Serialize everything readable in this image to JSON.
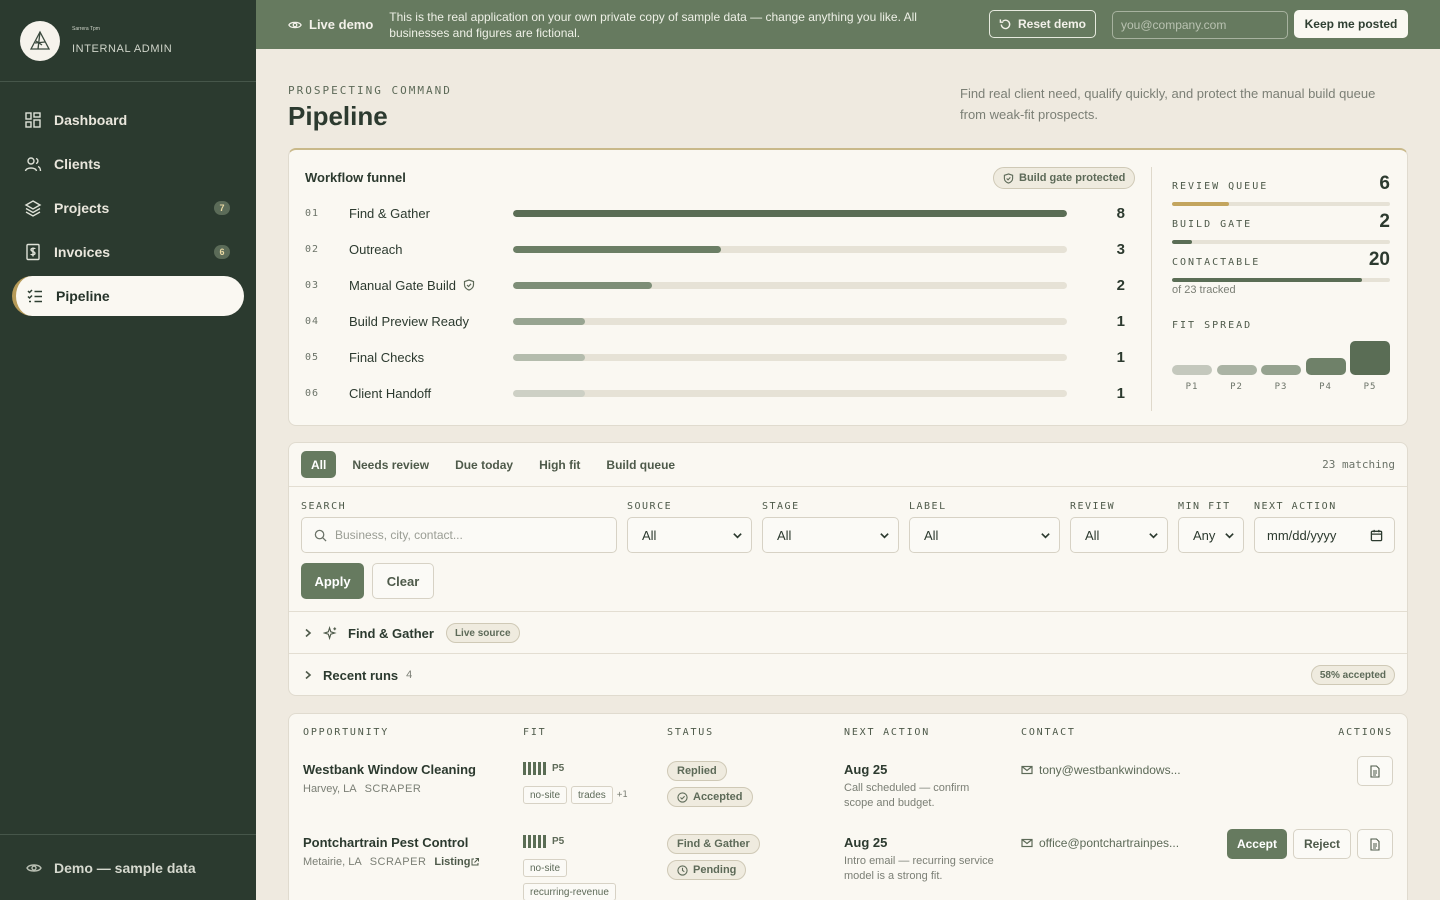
{
  "sidebar": {
    "brand_tiny": "Sarrera Tpm",
    "brand_sub": "INTERNAL ADMIN",
    "items": [
      {
        "label": "Dashboard",
        "icon": "dashboard-icon"
      },
      {
        "label": "Clients",
        "icon": "users-icon"
      },
      {
        "label": "Projects",
        "icon": "layers-icon",
        "count": "7"
      },
      {
        "label": "Invoices",
        "icon": "invoice-icon",
        "count": "6"
      },
      {
        "label": "Pipeline",
        "icon": "checklist-icon",
        "active": true
      }
    ],
    "footer": "Demo — sample data"
  },
  "banner": {
    "live_label": "Live demo",
    "message": "This is the real application on your own private copy of sample data — change anything you like. All businesses and figures are fictional.",
    "reset_label": "Reset demo",
    "email_placeholder": "you@company.com",
    "keep_label": "Keep me posted"
  },
  "header": {
    "eyebrow": "PROSPECTING COMMAND",
    "title": "Pipeline",
    "description": "Find real client need, qualify quickly, and protect the manual build queue from weak-fit prospects."
  },
  "funnel": {
    "title": "Workflow funnel",
    "badge": "Build gate protected",
    "max": 8,
    "stages": [
      {
        "num": "01",
        "label": "Find & Gather",
        "value": 8,
        "color": "#5a6d55"
      },
      {
        "num": "02",
        "label": "Outreach",
        "value": 3,
        "color": "#6b7e65"
      },
      {
        "num": "03",
        "label": "Manual Gate Build",
        "value": 2,
        "color": "#7d8e77",
        "shield": true
      },
      {
        "num": "04",
        "label": "Build Preview Ready",
        "value": 1,
        "color": "#97a491"
      },
      {
        "num": "05",
        "label": "Final Checks",
        "value": 1,
        "color": "#b4bcad"
      },
      {
        "num": "06",
        "label": "Client Handoff",
        "value": 1,
        "color": "#cdd0c5"
      }
    ],
    "metrics": [
      {
        "label": "REVIEW QUEUE",
        "value": "6",
        "fraction": 0.26,
        "color": "#c3a55e"
      },
      {
        "label": "BUILD GATE",
        "value": "2",
        "fraction": 0.09,
        "color": "#5a6d55"
      },
      {
        "label": "CONTACTABLE",
        "value": "20",
        "fraction": 0.87,
        "color": "#5a6d55"
      }
    ],
    "tracked": "of 23 tracked",
    "spread_label": "FIT SPREAD",
    "spread": [
      {
        "label": "P1",
        "value": 1,
        "color": "#c4c8bd"
      },
      {
        "label": "P2",
        "value": 1,
        "color": "#aab3a4"
      },
      {
        "label": "P3",
        "value": 1,
        "color": "#95a28f"
      },
      {
        "label": "P4",
        "value": 2,
        "color": "#6f8169"
      },
      {
        "label": "P5",
        "value": 4,
        "color": "#5a6d55"
      }
    ]
  },
  "filters": {
    "tabs": [
      "All",
      "Needs review",
      "Due today",
      "High fit",
      "Build queue"
    ],
    "active_tab": 0,
    "matching": "23 matching",
    "search_label": "SEARCH",
    "search_placeholder": "Business, city, contact...",
    "fields": [
      {
        "label": "SOURCE",
        "value": "All"
      },
      {
        "label": "STAGE",
        "value": "All"
      },
      {
        "label": "LABEL",
        "value": "All"
      },
      {
        "label": "REVIEW",
        "value": "All"
      },
      {
        "label": "MIN FIT",
        "value": "Any"
      },
      {
        "label": "NEXT ACTION",
        "value": "mm/dd/yyyy"
      }
    ],
    "apply_label": "Apply",
    "clear_label": "Clear",
    "find_gather": {
      "label": "Find & Gather",
      "badge": "Live source"
    },
    "recent_runs": {
      "label": "Recent runs",
      "count": "4",
      "badge": "58% accepted"
    }
  },
  "table": {
    "headers": [
      "OPPORTUNITY",
      "FIT",
      "STATUS",
      "NEXT ACTION",
      "CONTACT",
      "ACTIONS"
    ],
    "rows": [
      {
        "name": "Westbank Window Cleaning",
        "location": "Harvey, LA",
        "source": "SCRAPER",
        "fit": "P5",
        "tags": [
          "no-site",
          "trades"
        ],
        "more": "+1",
        "status": [
          "Replied",
          "Accepted"
        ],
        "date": "Aug  25",
        "note": "Call scheduled — confirm scope and budget.",
        "contact": "tony@westbankwindows..."
      },
      {
        "name": "Pontchartrain Pest Control",
        "location": "Metairie, LA",
        "source": "SCRAPER",
        "listing": "Listing",
        "fit": "P5",
        "tags": [
          "no-site",
          "recurring-revenue"
        ],
        "status": [
          "Find & Gather",
          "Pending"
        ],
        "date": "Aug  25",
        "note": "Intro email — recurring service model is a strong fit.",
        "contact": "office@pontchartrainpes...",
        "accept_label": "Accept",
        "reject_label": "Reject"
      }
    ]
  }
}
